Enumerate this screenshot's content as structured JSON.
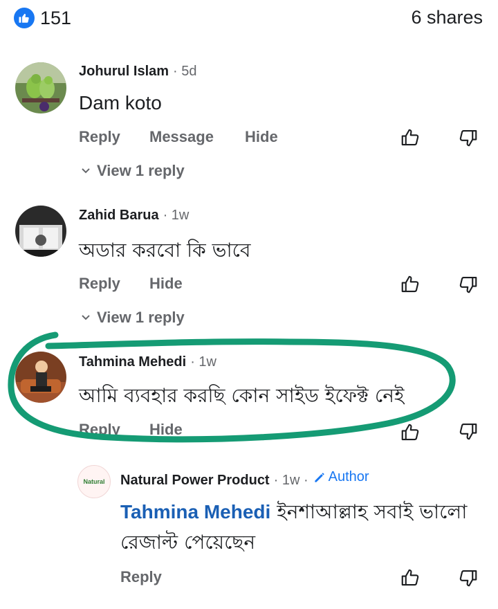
{
  "reactions": {
    "count": "151",
    "shares": "6 shares"
  },
  "comments": [
    {
      "name": "Johurul Islam",
      "time": "· 5d",
      "text": "Dam koto",
      "actions": [
        "Reply",
        "Message",
        "Hide"
      ],
      "view_replies": "View 1 reply"
    },
    {
      "name": "Zahid Barua",
      "time": "· 1w",
      "text": "অডার করবো কি ভাবে",
      "actions": [
        "Reply",
        "Hide"
      ],
      "view_replies": "View 1 reply"
    },
    {
      "name": "Tahmina Mehedi",
      "time": "· 1w",
      "text": "আমি ব্যবহার করছি কোন সাইড ইফেক্ট নেই",
      "actions": [
        "Reply",
        "Hide"
      ]
    }
  ],
  "reply": {
    "name": "Natural Power Product",
    "time": "· 1w ·",
    "badge": "Author",
    "avatar_text": "Natural",
    "mention": "Tahmina Mehedi",
    "text_line1": " ইনশাআল্লাহ সবাই ভালো",
    "text_line2": "রেজাল্ট পেয়েছেন",
    "actions": [
      "Reply"
    ]
  },
  "colors": {
    "accent": "#1877f2",
    "highlight": "#159b74",
    "muted": "#65676b"
  }
}
